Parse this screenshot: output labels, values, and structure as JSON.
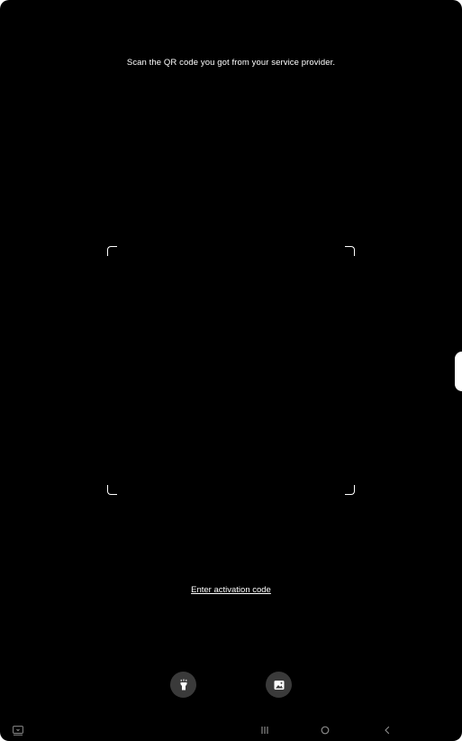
{
  "scanner": {
    "instruction": "Scan the QR code you got from your service provider."
  },
  "actions": {
    "activation_link": "Enter activation code"
  },
  "buttons": {
    "flashlight_icon": "flashlight-icon",
    "gallery_icon": "gallery-icon"
  },
  "navbar": {
    "keyboard_icon": "keyboard-icon",
    "recents_icon": "recents-icon",
    "home_icon": "home-icon",
    "back_icon": "back-icon"
  },
  "colors": {
    "background": "#000000",
    "text": "#ffffff",
    "button_bg": "#3a3a3a",
    "nav_icon": "#8a8a8a"
  }
}
